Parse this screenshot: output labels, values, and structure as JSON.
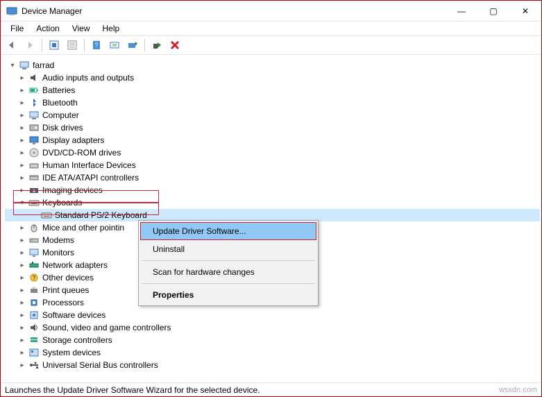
{
  "window": {
    "title": "Device Manager",
    "controls": {
      "min": "—",
      "max": "▢",
      "close": "✕"
    }
  },
  "menubar": [
    "File",
    "Action",
    "View",
    "Help"
  ],
  "root": "farrad",
  "devices": [
    "Audio inputs and outputs",
    "Batteries",
    "Bluetooth",
    "Computer",
    "Disk drives",
    "Display adapters",
    "DVD/CD-ROM drives",
    "Human Interface Devices",
    "IDE ATA/ATAPI controllers",
    "Imaging devices",
    "Keyboards",
    "Mice and other pointin",
    "Modems",
    "Monitors",
    "Network adapters",
    "Other devices",
    "Print queues",
    "Processors",
    "Software devices",
    "Sound, video and game controllers",
    "Storage controllers",
    "System devices",
    "Universal Serial Bus controllers"
  ],
  "keyboards_child": "Standard PS/2 Keyboard",
  "context_menu": [
    "Update Driver Software...",
    "Uninstall",
    "Scan for hardware changes",
    "Properties"
  ],
  "status_text": "Launches the Update Driver Software Wizard for the selected device.",
  "watermark": "wsxdn.com"
}
